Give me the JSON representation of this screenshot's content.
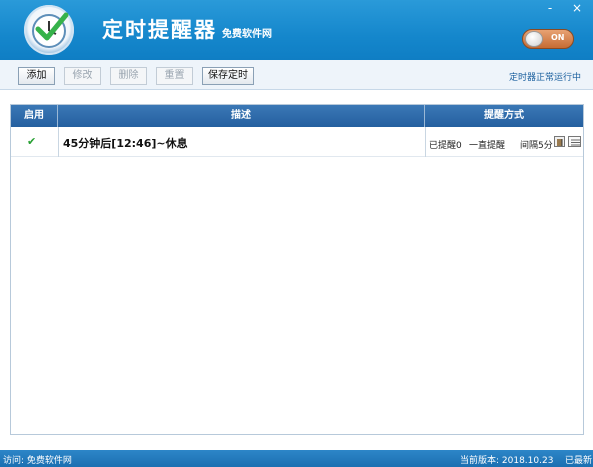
{
  "header": {
    "title": "定时提醒器",
    "subtitle": "免费软件网",
    "minimize": "-",
    "close": "×",
    "toggle_label": "ON"
  },
  "toolbar": {
    "add": "添加",
    "edit": "修改",
    "delete": "删除",
    "reset": "重置",
    "save": "保存定时",
    "status": "定时器正常运行中"
  },
  "table": {
    "columns": [
      "启用",
      "描述",
      "提醒方式"
    ],
    "rows": [
      {
        "enabled_mark": "✔",
        "description": "45分钟后[12:46]~休息",
        "reminded": "已提醒0",
        "mode": "一直提醒",
        "interval": "间隔5分"
      }
    ]
  },
  "statusbar": {
    "left": "访问: 免费软件网",
    "version": "当前版本: 2018.10.23",
    "latest": "已最新"
  },
  "colors": {
    "header_blue": "#1587cc",
    "table_header": "#245f9f",
    "status_blue": "#1b6fb1",
    "check_green": "#27a032"
  }
}
